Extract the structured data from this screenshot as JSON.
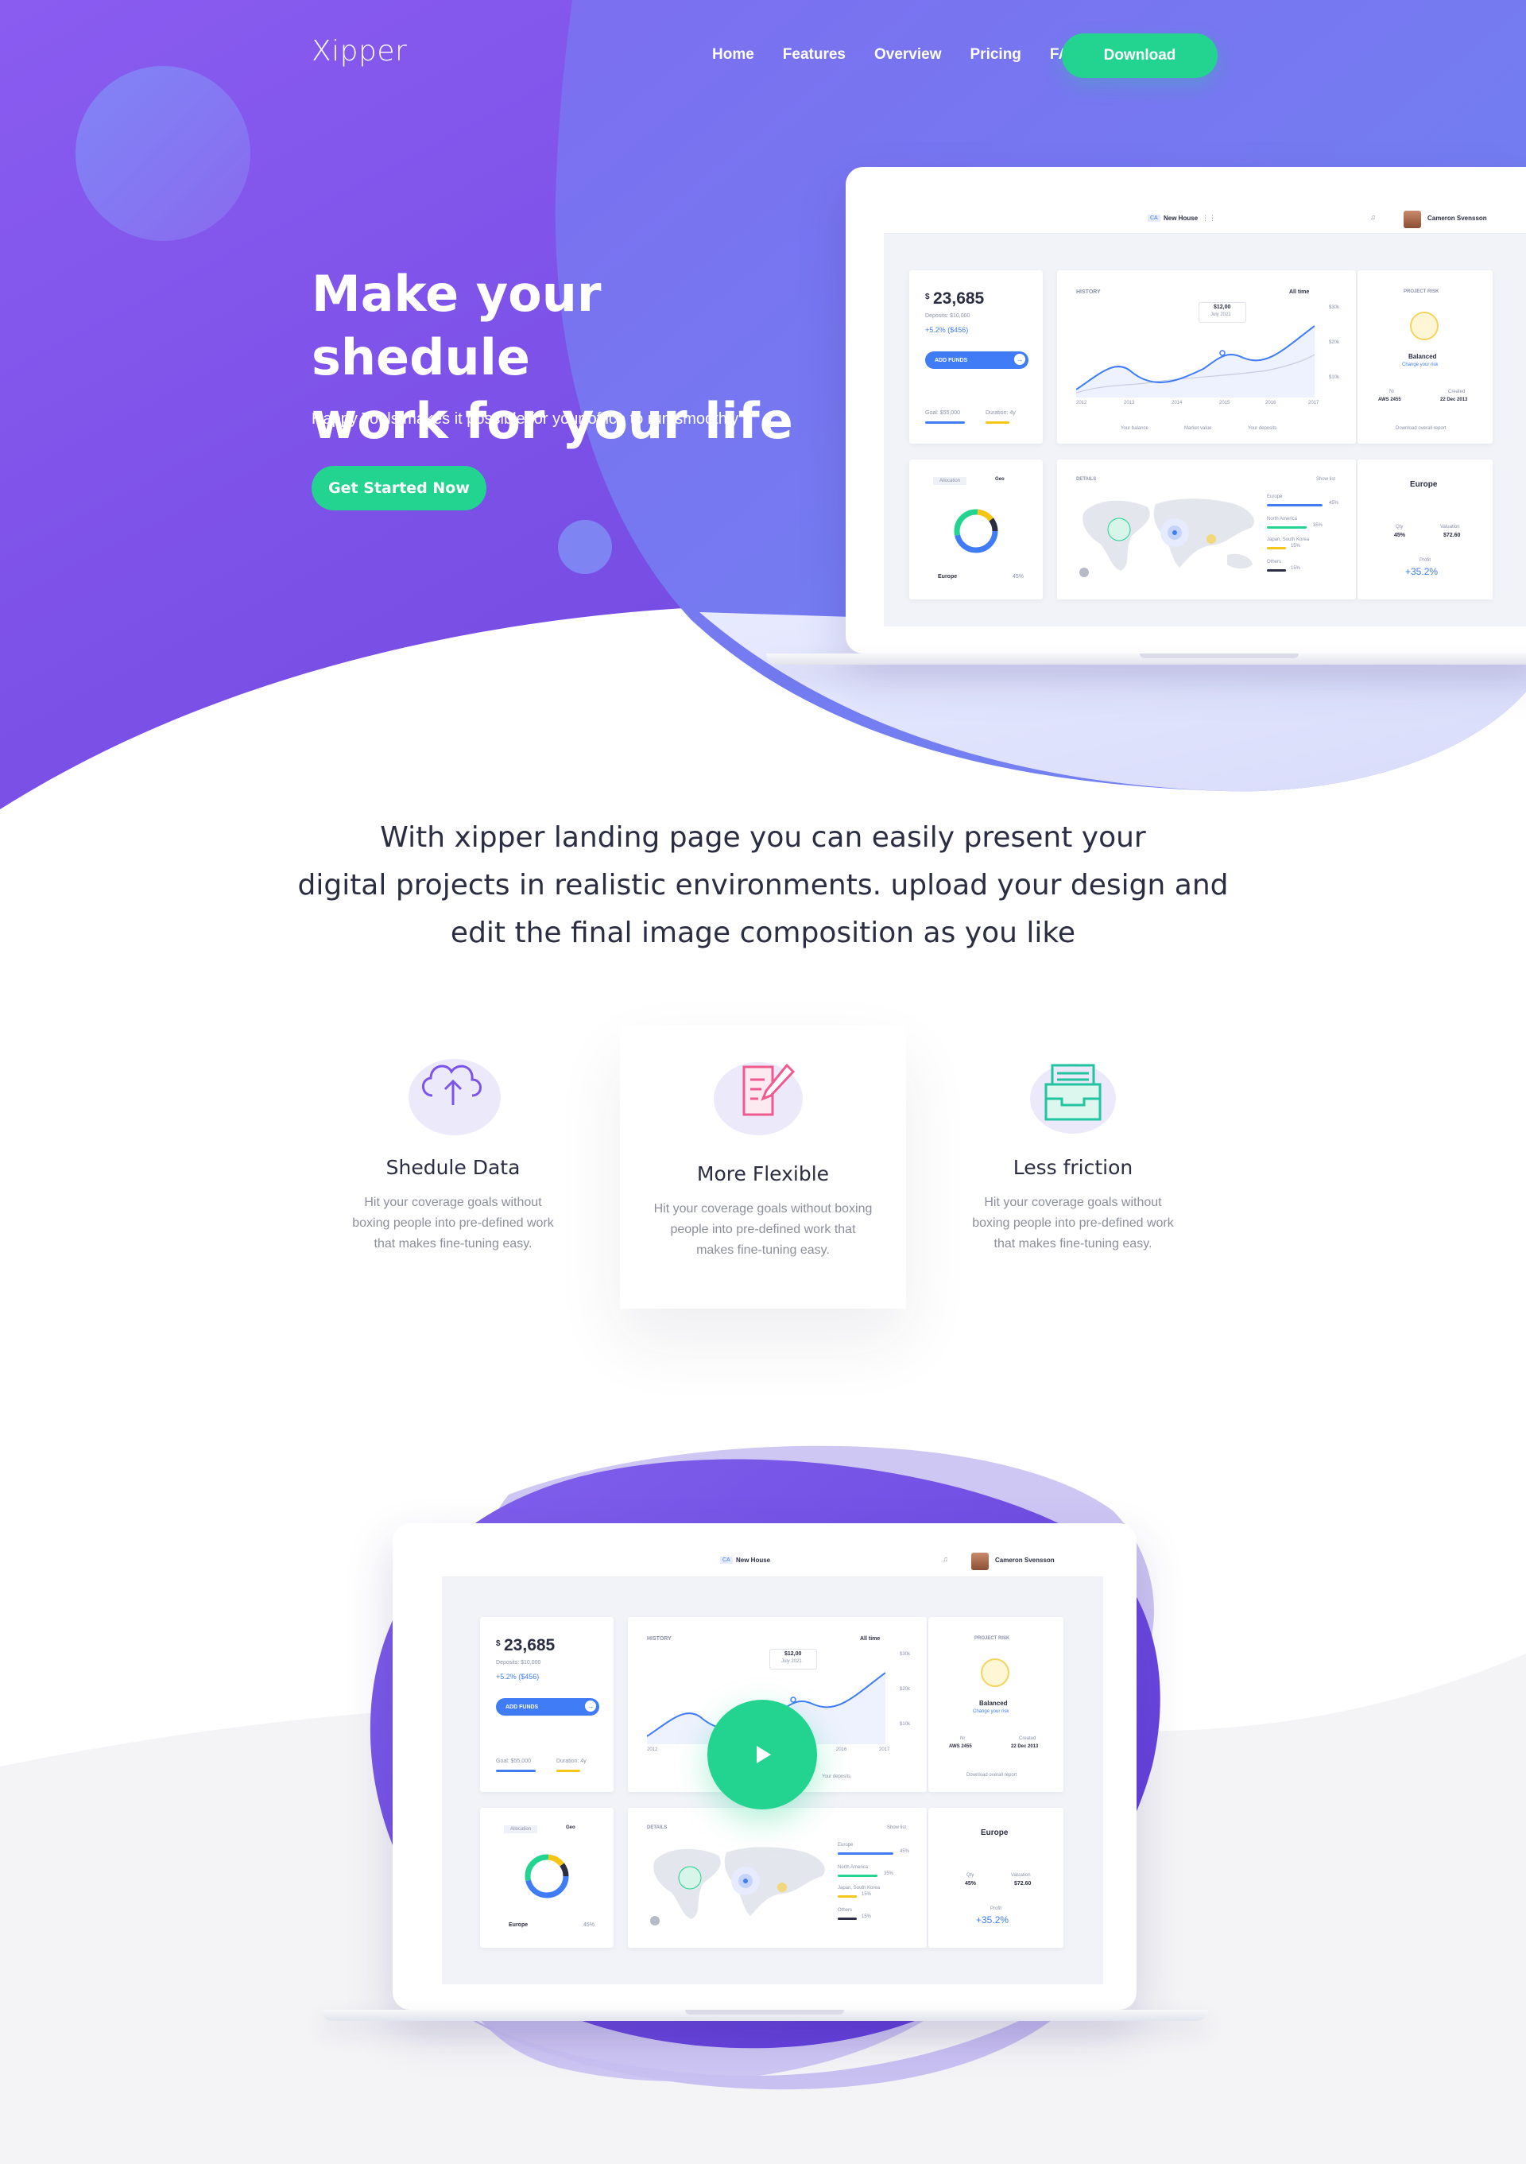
{
  "header": {
    "logo": "Xipper",
    "nav": [
      "Home",
      "Features",
      "Overview",
      "Pricing",
      "FAQ"
    ],
    "download_label": "Download"
  },
  "hero": {
    "title_line1": "Make your shedule",
    "title_line2": "work for your life",
    "subtitle": "Happy Tools makes it possible for your office to run smoothly",
    "cta_label": "Get Started Now"
  },
  "dashboard": {
    "project_chip": "CA",
    "project_name": "New House",
    "user_name": "Cameron Svensson",
    "balance": "23,685",
    "currency": "$",
    "deposits": "Deposits: $10,000",
    "change": "+5.2% ($456)",
    "add_funds": "ADD FUNDS",
    "goal": "Goal: $55,000",
    "duration": "Duration: 4y",
    "history_label": "HISTORY",
    "history_filter": "All time",
    "tooltip_value": "$12,00",
    "tooltip_date": "July 2021",
    "y_ticks": [
      "$30k",
      "$20k",
      "$10k"
    ],
    "x_ticks": [
      "2012",
      "2013",
      "2014",
      "2015",
      "2016",
      "2017"
    ],
    "legend": [
      "Your balance",
      "Market value",
      "Your deposits"
    ],
    "risk_label": "PROJECT RISK",
    "risk_value": "Balanced",
    "risk_link": "Change your risk",
    "nr_label": "Nr",
    "nr_value": "AWS 2455",
    "created_label": "Created",
    "created_value": "22 Dec 2013",
    "download_report": "Download overall report",
    "alloc_tab": "Allocation",
    "geo_tab": "Geo",
    "alloc_region": "Europe",
    "alloc_pct": "45%",
    "details_label": "DETAILS",
    "show_list": "Show list",
    "regions": [
      {
        "name": "Europe",
        "pct": "45%",
        "color": "#3f7cf6"
      },
      {
        "name": "North America",
        "pct": "35%",
        "color": "#22d48f"
      },
      {
        "name": "Japan, South Korea",
        "pct": "15%",
        "color": "#f5c518"
      },
      {
        "name": "Others",
        "pct": "15%",
        "color": "#2b2d42"
      }
    ],
    "region_title": "Europe",
    "qty_label": "Qty",
    "qty_value": "45%",
    "valuation_label": "Valuation",
    "valuation_value": "$72.60",
    "profit_label": "Profit",
    "profit_value": "+35.2%"
  },
  "intro": {
    "line1": "With xipper landing page you can easily present your",
    "line2": "digital projects in realistic environments. upload your design and",
    "line3": "edit the final image composition as you like"
  },
  "features": [
    {
      "icon": "cloud-upload-icon",
      "title": "Shedule Data",
      "text": "Hit your coverage goals without boxing people into pre-defined work that makes fine-tuning easy."
    },
    {
      "icon": "edit-document-icon",
      "title": "More Flexible",
      "text": "Hit your coverage goals without boxing people into pre-defined work that makes fine-tuning easy."
    },
    {
      "icon": "inbox-tray-icon",
      "title": "Less friction",
      "text": "Hit your coverage goals without boxing people into pre-defined work that makes fine-tuning easy."
    }
  ],
  "colors": {
    "purple": "#7a55e8",
    "blue": "#6b7ff0",
    "green": "#22d48f",
    "accent_blue": "#3f7cf6"
  }
}
